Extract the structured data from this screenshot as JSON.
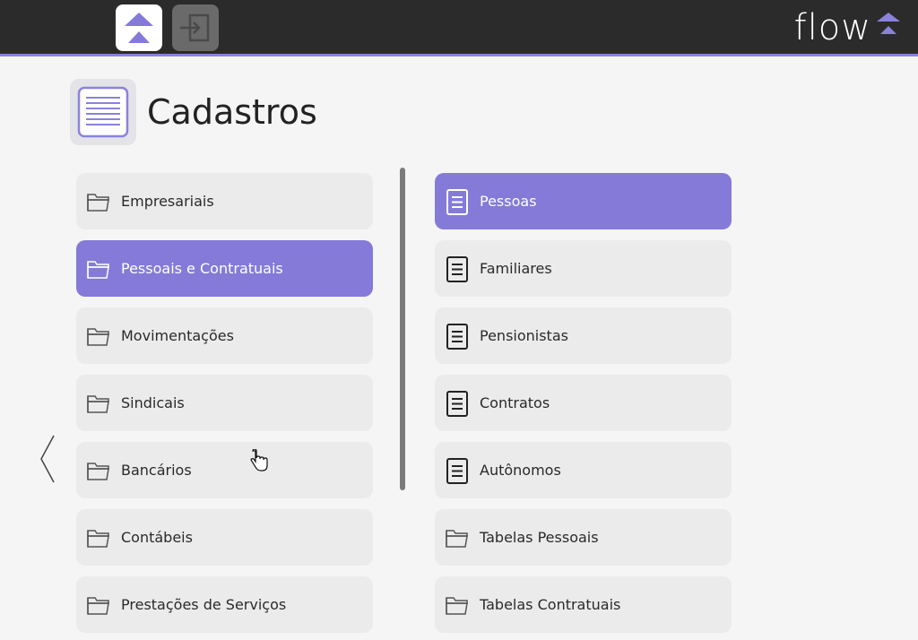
{
  "app": {
    "logo_text": "flow"
  },
  "colors": {
    "accent": "#857ad8",
    "topbar": "#2b2b2b"
  },
  "header": {
    "title": "Cadastros",
    "icon": "list-document-icon"
  },
  "left_menu": [
    {
      "label": "Empresariais",
      "icon": "folder-icon",
      "active": false
    },
    {
      "label": "Pessoais e Contratuais",
      "icon": "folder-icon",
      "active": true
    },
    {
      "label": "Movimentações",
      "icon": "folder-icon",
      "active": false
    },
    {
      "label": "Sindicais",
      "icon": "folder-icon",
      "active": false
    },
    {
      "label": "Bancários",
      "icon": "folder-icon",
      "active": false
    },
    {
      "label": "Contábeis",
      "icon": "folder-icon",
      "active": false
    },
    {
      "label": "Prestações de Serviços",
      "icon": "folder-icon",
      "active": false
    }
  ],
  "right_menu": [
    {
      "label": "Pessoas",
      "icon": "document-icon",
      "active": true
    },
    {
      "label": "Familiares",
      "icon": "document-icon",
      "active": false
    },
    {
      "label": "Pensionistas",
      "icon": "document-icon",
      "active": false
    },
    {
      "label": "Contratos",
      "icon": "document-icon",
      "active": false
    },
    {
      "label": "Autônomos",
      "icon": "document-icon",
      "active": false
    },
    {
      "label": "Tabelas Pessoais",
      "icon": "folder-icon",
      "active": false
    },
    {
      "label": "Tabelas Contratuais",
      "icon": "folder-icon",
      "active": false
    }
  ]
}
